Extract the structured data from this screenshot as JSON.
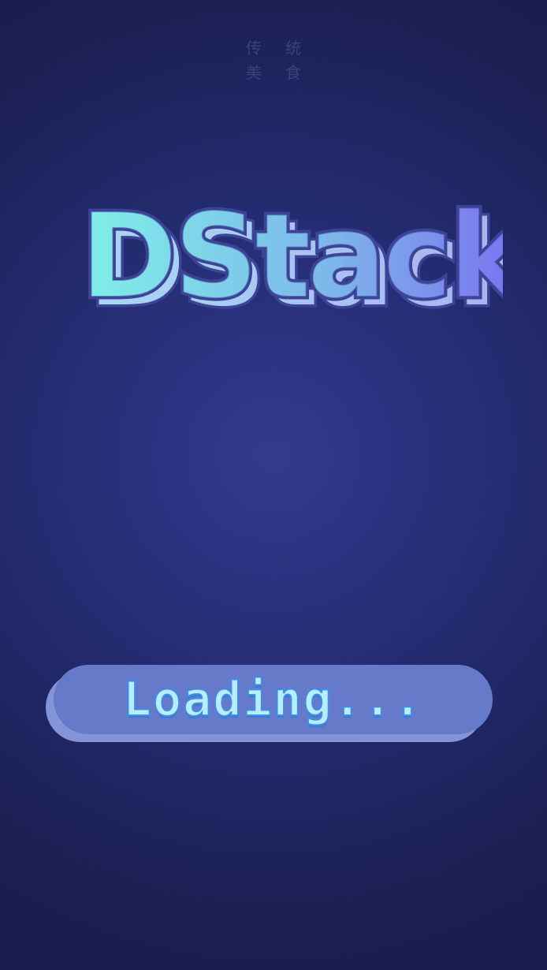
{
  "header": {
    "line1": "传 统",
    "line2": "美 食"
  },
  "logo": {
    "text": "DStack",
    "gradient_start": "#7ff0e8",
    "gradient_end": "#7a6ef0",
    "outline_color": "#3c4498"
  },
  "loading": {
    "label": "Loading..."
  }
}
